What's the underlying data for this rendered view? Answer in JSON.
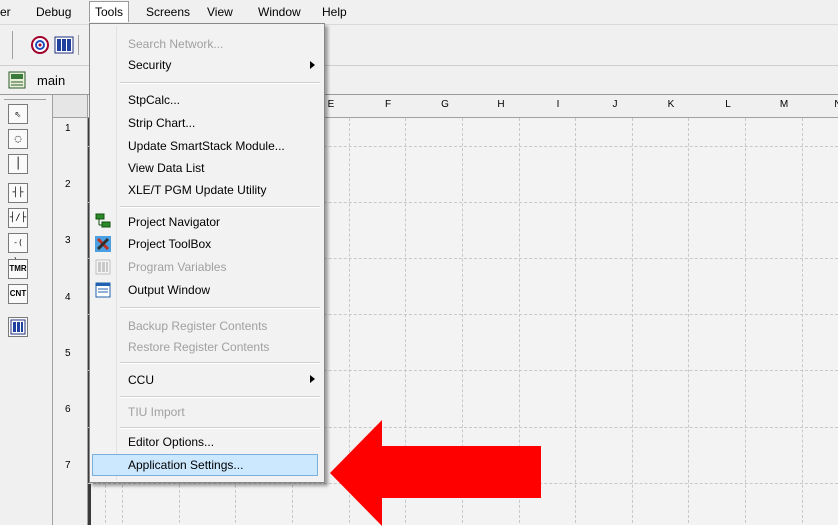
{
  "menubar": {
    "items": [
      "er",
      "Debug",
      "Tools",
      "Screens",
      "View",
      "Window",
      "Help"
    ],
    "active": "Tools"
  },
  "tab": {
    "label": "main"
  },
  "grid": {
    "columns": [
      "E",
      "F",
      "G",
      "H",
      "I",
      "J",
      "K",
      "L",
      "M",
      "N"
    ],
    "rows": [
      "1",
      "2",
      "3",
      "4",
      "5",
      "6",
      "7"
    ]
  },
  "palette": {
    "items": [
      {
        "glyph": "⇖",
        "icon": "pointer-icon"
      },
      {
        "glyph": "◌",
        "icon": "comment-icon"
      },
      {
        "glyph": "│",
        "icon": "wire-icon"
      },
      {
        "glyph": "┤├",
        "icon": "contact-no-icon"
      },
      {
        "glyph": "┤/├",
        "icon": "contact-nc-icon"
      },
      {
        "glyph": "-( )-",
        "icon": "coil-icon"
      },
      {
        "glyph": "TMR",
        "icon": "timer-icon"
      },
      {
        "glyph": "CNT",
        "icon": "counter-icon"
      },
      {
        "glyph": "",
        "icon": "function-block-icon"
      }
    ]
  },
  "tools_menu": {
    "items": [
      {
        "label": "Search Network...",
        "disabled": true
      },
      {
        "label": "Security",
        "submenu": true
      },
      {
        "label": "StpCalc..."
      },
      {
        "label": "Strip Chart..."
      },
      {
        "label": "Update SmartStack Module..."
      },
      {
        "label": "View Data List"
      },
      {
        "label": "XLE/T PGM Update Utility"
      },
      {
        "label": "Project Navigator",
        "icon": "project-navigator-icon"
      },
      {
        "label": "Project ToolBox",
        "icon": "project-toolbox-icon"
      },
      {
        "label": "Program Variables",
        "disabled": true,
        "icon": "program-variables-icon"
      },
      {
        "label": "Output Window",
        "icon": "output-window-icon"
      },
      {
        "label": "Backup Register Contents",
        "disabled": true
      },
      {
        "label": "Restore Register Contents",
        "disabled": true
      },
      {
        "label": "CCU",
        "submenu": true
      },
      {
        "label": "TIU Import",
        "disabled": true
      },
      {
        "label": "Editor Options..."
      },
      {
        "label": "Application Settings...",
        "highlighted": true
      }
    ]
  },
  "colors": {
    "highlight": "#cce8ff",
    "arrow": "#ff0000",
    "disabled_text": "#a0a0a0"
  }
}
